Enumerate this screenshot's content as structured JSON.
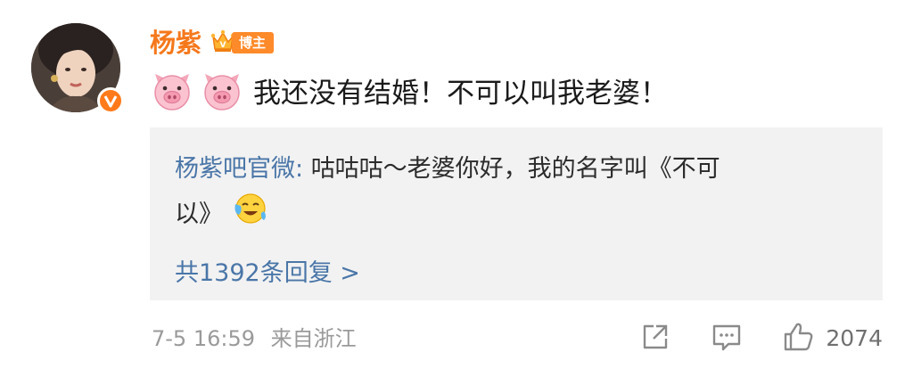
{
  "colors": {
    "username": "#f5781c",
    "link": "#4a76a8",
    "reply_box_bg": "#f2f2f2",
    "badge_bg": "#ff8a29",
    "verified": "#ff7a1a",
    "meta_text": "#9a9a9a"
  },
  "user": {
    "name": "杨紫",
    "badge": "博主",
    "crown_icon": "crown-icon",
    "verified_icon": "verified-v-icon"
  },
  "comment": {
    "emojis": [
      "pig-face-emoji",
      "pig-face-emoji"
    ],
    "text": "我还没有结婚！不可以叫我老婆！"
  },
  "reply": {
    "author": "杨紫吧官微",
    "separator": ": ",
    "text_line1": "咕咕咕～老婆你好，我的名字叫《不可",
    "text_line2": "以》",
    "emoji": "tears-of-joy-emoji",
    "more_replies": "共1392条回复 >"
  },
  "meta": {
    "time": "7-5 16:59",
    "location": "来自浙江"
  },
  "actions": {
    "share_icon": "share-icon",
    "comment_icon": "comment-icon",
    "like_icon": "thumbs-up-icon",
    "like_count": "2074"
  }
}
